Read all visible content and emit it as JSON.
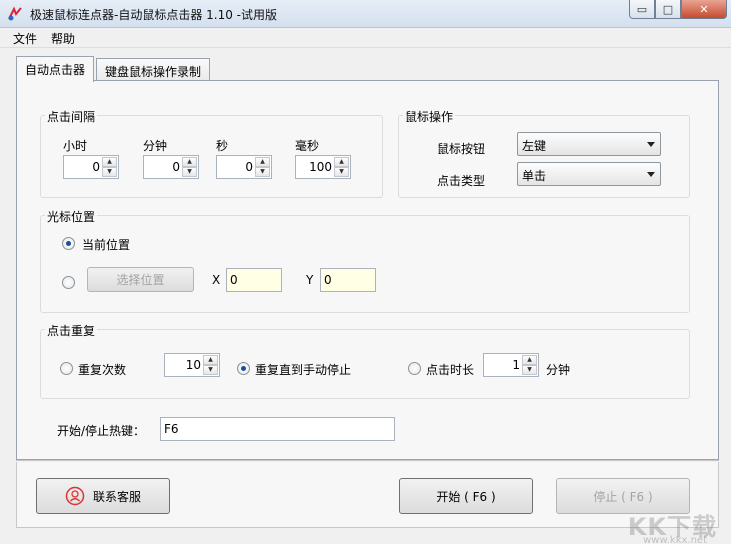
{
  "window": {
    "title": "极速鼠标连点器-自动鼠标点击器 1.10 -试用版",
    "min_symbol": "▭",
    "max_symbol": "□",
    "close_symbol": "✕"
  },
  "menu": {
    "file": "文件",
    "help": "帮助"
  },
  "tabs": {
    "auto_clicker": "自动点击器",
    "record": "键盘鼠标操作录制"
  },
  "interval": {
    "title": "点击间隔",
    "hour_label": "小时",
    "hour_value": "0",
    "minute_label": "分钟",
    "minute_value": "0",
    "second_label": "秒",
    "second_value": "0",
    "ms_label": "毫秒",
    "ms_value": "100"
  },
  "mouse_op": {
    "title": "鼠标操作",
    "button_label": "鼠标按钮",
    "button_value": "左键",
    "click_type_label": "点击类型",
    "click_type_value": "单击"
  },
  "cursor": {
    "title": "光标位置",
    "current_label": "当前位置",
    "select_button": "选择位置",
    "x_label": "X",
    "x_value": "0",
    "y_label": "Y",
    "y_value": "0"
  },
  "repeat": {
    "title": "点击重复",
    "count_label": "重复次数",
    "count_value": "10",
    "until_stop_label": "重复直到手动停止",
    "duration_label": "点击时长",
    "duration_value": "1",
    "duration_unit": "分钟"
  },
  "hotkey": {
    "label": "开始/停止热键：",
    "value": "F6"
  },
  "buttons": {
    "contact": "联系客服",
    "start": "开始 ( F6 )",
    "stop": "停止 ( F6 )"
  },
  "watermark": {
    "main": "KK下载",
    "sub": "www.kkx.net"
  }
}
